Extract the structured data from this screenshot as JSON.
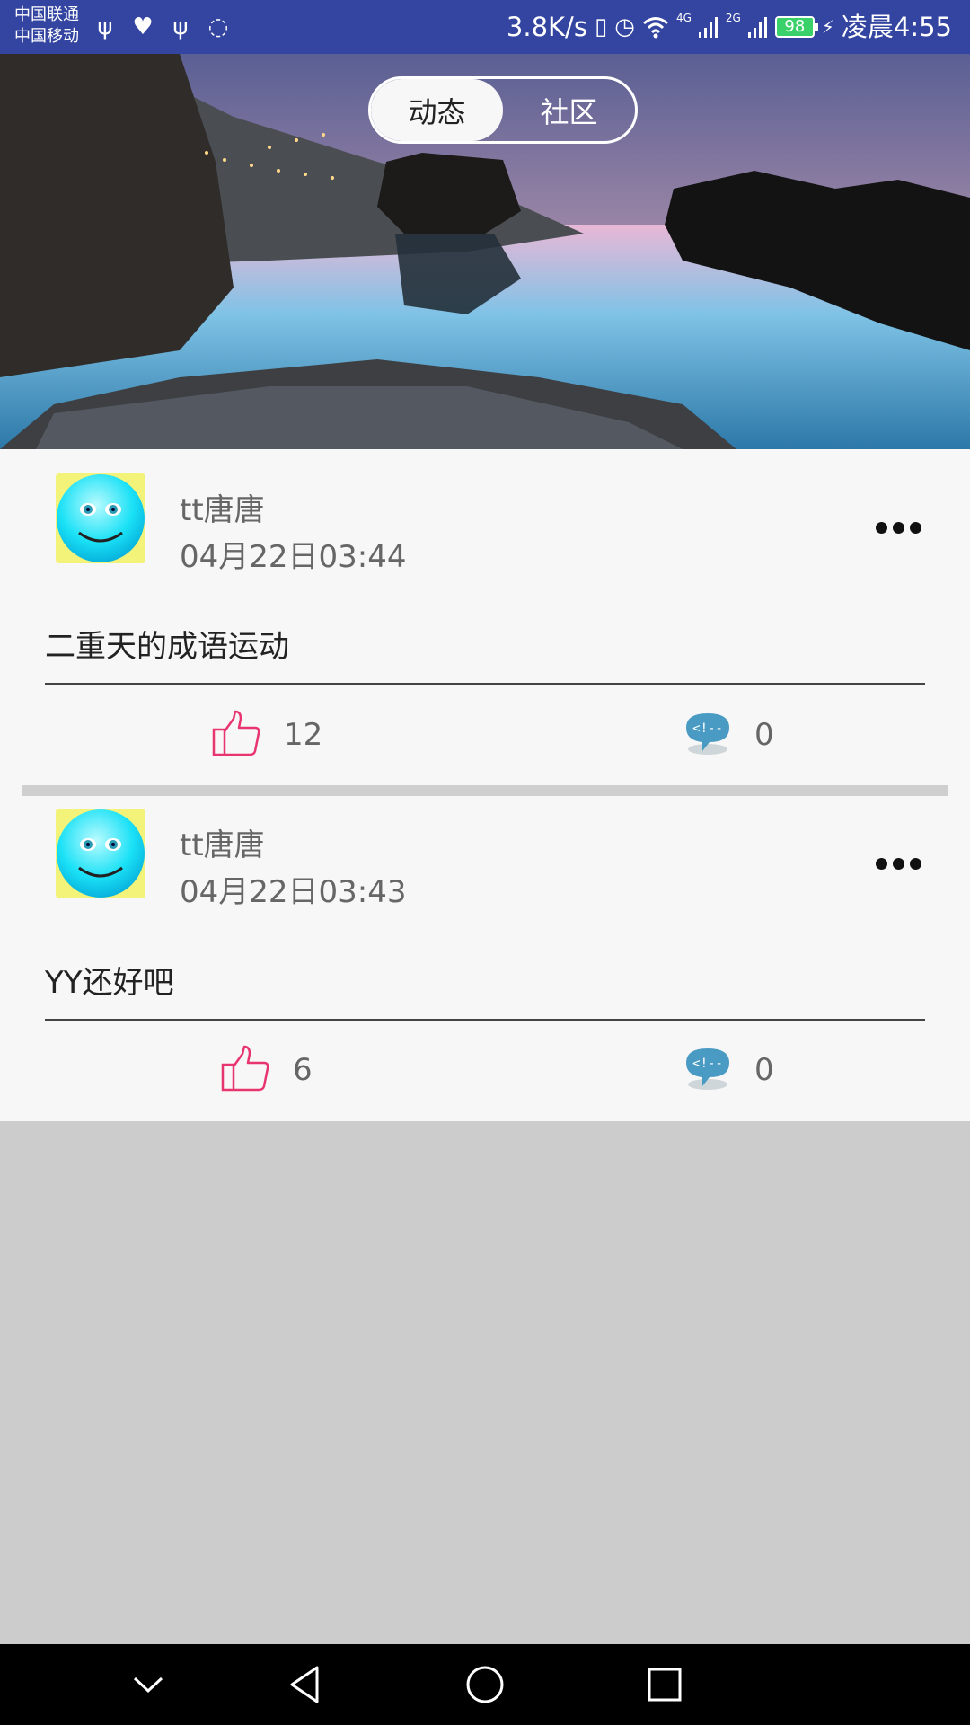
{
  "status_bar": {
    "carrier_1": "中国联通",
    "carrier_2": "中国移动",
    "left_icons": [
      "usb-icon",
      "health-icon",
      "usb-icon",
      "sync-icon"
    ],
    "net_speed": "3.8K/s",
    "signal_labels": [
      "4G",
      "2G"
    ],
    "battery": "98",
    "time": "凌晨4:55"
  },
  "header": {
    "tabs": [
      {
        "label": "动态",
        "active": true
      },
      {
        "label": "社区",
        "active": false
      }
    ]
  },
  "posts": [
    {
      "username": "tt唐唐",
      "time": "04月22日03:44",
      "content": "二重天的成语运动",
      "likes": "12",
      "comments": "0"
    },
    {
      "username": "tt唐唐",
      "time": "04月22日03:43",
      "content": "YY还好吧",
      "likes": "6",
      "comments": "0"
    }
  ],
  "nav_bar": {
    "buttons": [
      "collapse-icon",
      "back-icon",
      "home-icon",
      "recents-icon"
    ]
  },
  "colors": {
    "status_bar": "#3345a0",
    "like": "#e8356f",
    "comment": "#4a9bc4",
    "background": "#cccccc"
  }
}
